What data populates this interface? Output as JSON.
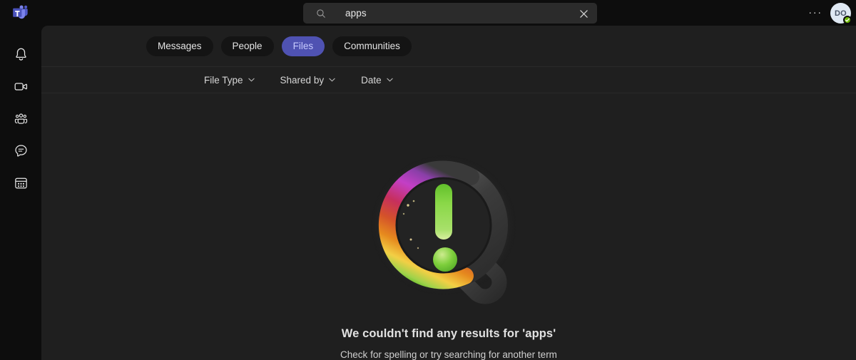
{
  "app": {
    "name": "Microsoft Teams",
    "logo_icon": "teams-logo-icon"
  },
  "titlebar": {
    "search": {
      "value": "apps",
      "placeholder": "Search",
      "search_icon": "search-icon",
      "clear_icon": "close-icon",
      "clear_label": "Clear search"
    },
    "more_options_label": "···",
    "more_options_name": "more-options-icon",
    "avatar": {
      "initials": "DO",
      "presence": "Available",
      "presence_color": "#6bb700",
      "presence_icon": "checkmark-icon"
    }
  },
  "rail": {
    "items": [
      {
        "name": "activity",
        "label": "Activity",
        "icon": "bell-icon"
      },
      {
        "name": "meet",
        "label": "Meet",
        "icon": "video-camera-icon"
      },
      {
        "name": "teams",
        "label": "Teams",
        "icon": "people-icon"
      },
      {
        "name": "chat",
        "label": "Chat",
        "icon": "chat-bubble-icon"
      },
      {
        "name": "calendar",
        "label": "Calendar",
        "icon": "calendar-icon"
      }
    ]
  },
  "search_results": {
    "tabs": [
      {
        "label": "Messages",
        "selected": false
      },
      {
        "label": "People",
        "selected": false
      },
      {
        "label": "Files",
        "selected": true
      },
      {
        "label": "Communities",
        "selected": false
      }
    ],
    "filters": [
      {
        "label": "File Type",
        "icon": "chevron-down-icon"
      },
      {
        "label": "Shared by",
        "icon": "chevron-down-icon"
      },
      {
        "label": "Date",
        "icon": "chevron-down-icon"
      }
    ],
    "empty_state": {
      "illustration": "magnifier-no-results-illustration",
      "title": "We couldn't find any results for 'apps'",
      "subtitle": "Check for spelling or try searching for another term"
    }
  },
  "colors": {
    "accent": "#4f52b2",
    "accent_text": "#c7cbff",
    "panel_bg": "#1f1f1f",
    "rail_bg": "#0d0d0d",
    "search_bg": "#2b2b2b",
    "presence_green": "#6bb700"
  }
}
